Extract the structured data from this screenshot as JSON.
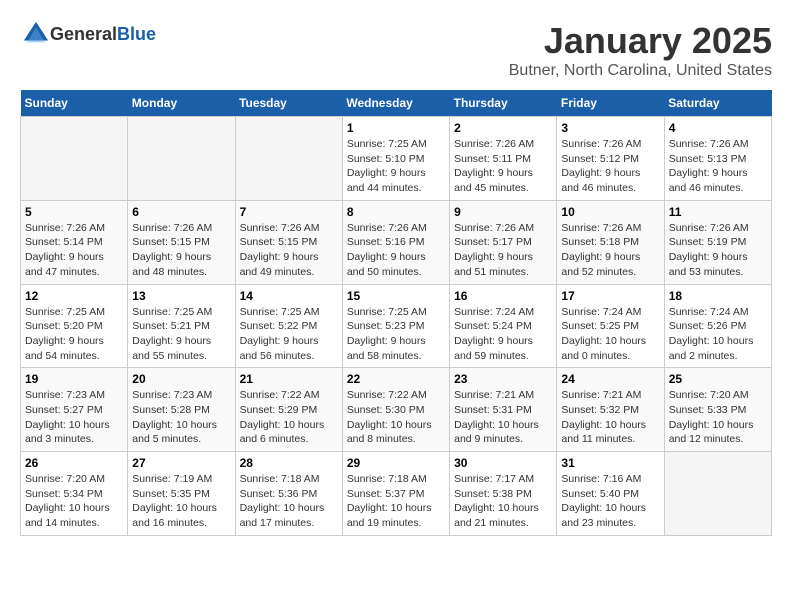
{
  "logo": {
    "text_general": "General",
    "text_blue": "Blue"
  },
  "title": "January 2025",
  "subtitle": "Butner, North Carolina, United States",
  "days_of_week": [
    "Sunday",
    "Monday",
    "Tuesday",
    "Wednesday",
    "Thursday",
    "Friday",
    "Saturday"
  ],
  "weeks": [
    [
      {
        "day": "",
        "sunrise": "",
        "sunset": "",
        "daylight": ""
      },
      {
        "day": "",
        "sunrise": "",
        "sunset": "",
        "daylight": ""
      },
      {
        "day": "",
        "sunrise": "",
        "sunset": "",
        "daylight": ""
      },
      {
        "day": "1",
        "sunrise": "Sunrise: 7:25 AM",
        "sunset": "Sunset: 5:10 PM",
        "daylight": "Daylight: 9 hours and 44 minutes."
      },
      {
        "day": "2",
        "sunrise": "Sunrise: 7:26 AM",
        "sunset": "Sunset: 5:11 PM",
        "daylight": "Daylight: 9 hours and 45 minutes."
      },
      {
        "day": "3",
        "sunrise": "Sunrise: 7:26 AM",
        "sunset": "Sunset: 5:12 PM",
        "daylight": "Daylight: 9 hours and 46 minutes."
      },
      {
        "day": "4",
        "sunrise": "Sunrise: 7:26 AM",
        "sunset": "Sunset: 5:13 PM",
        "daylight": "Daylight: 9 hours and 46 minutes."
      }
    ],
    [
      {
        "day": "5",
        "sunrise": "Sunrise: 7:26 AM",
        "sunset": "Sunset: 5:14 PM",
        "daylight": "Daylight: 9 hours and 47 minutes."
      },
      {
        "day": "6",
        "sunrise": "Sunrise: 7:26 AM",
        "sunset": "Sunset: 5:15 PM",
        "daylight": "Daylight: 9 hours and 48 minutes."
      },
      {
        "day": "7",
        "sunrise": "Sunrise: 7:26 AM",
        "sunset": "Sunset: 5:15 PM",
        "daylight": "Daylight: 9 hours and 49 minutes."
      },
      {
        "day": "8",
        "sunrise": "Sunrise: 7:26 AM",
        "sunset": "Sunset: 5:16 PM",
        "daylight": "Daylight: 9 hours and 50 minutes."
      },
      {
        "day": "9",
        "sunrise": "Sunrise: 7:26 AM",
        "sunset": "Sunset: 5:17 PM",
        "daylight": "Daylight: 9 hours and 51 minutes."
      },
      {
        "day": "10",
        "sunrise": "Sunrise: 7:26 AM",
        "sunset": "Sunset: 5:18 PM",
        "daylight": "Daylight: 9 hours and 52 minutes."
      },
      {
        "day": "11",
        "sunrise": "Sunrise: 7:26 AM",
        "sunset": "Sunset: 5:19 PM",
        "daylight": "Daylight: 9 hours and 53 minutes."
      }
    ],
    [
      {
        "day": "12",
        "sunrise": "Sunrise: 7:25 AM",
        "sunset": "Sunset: 5:20 PM",
        "daylight": "Daylight: 9 hours and 54 minutes."
      },
      {
        "day": "13",
        "sunrise": "Sunrise: 7:25 AM",
        "sunset": "Sunset: 5:21 PM",
        "daylight": "Daylight: 9 hours and 55 minutes."
      },
      {
        "day": "14",
        "sunrise": "Sunrise: 7:25 AM",
        "sunset": "Sunset: 5:22 PM",
        "daylight": "Daylight: 9 hours and 56 minutes."
      },
      {
        "day": "15",
        "sunrise": "Sunrise: 7:25 AM",
        "sunset": "Sunset: 5:23 PM",
        "daylight": "Daylight: 9 hours and 58 minutes."
      },
      {
        "day": "16",
        "sunrise": "Sunrise: 7:24 AM",
        "sunset": "Sunset: 5:24 PM",
        "daylight": "Daylight: 9 hours and 59 minutes."
      },
      {
        "day": "17",
        "sunrise": "Sunrise: 7:24 AM",
        "sunset": "Sunset: 5:25 PM",
        "daylight": "Daylight: 10 hours and 0 minutes."
      },
      {
        "day": "18",
        "sunrise": "Sunrise: 7:24 AM",
        "sunset": "Sunset: 5:26 PM",
        "daylight": "Daylight: 10 hours and 2 minutes."
      }
    ],
    [
      {
        "day": "19",
        "sunrise": "Sunrise: 7:23 AM",
        "sunset": "Sunset: 5:27 PM",
        "daylight": "Daylight: 10 hours and 3 minutes."
      },
      {
        "day": "20",
        "sunrise": "Sunrise: 7:23 AM",
        "sunset": "Sunset: 5:28 PM",
        "daylight": "Daylight: 10 hours and 5 minutes."
      },
      {
        "day": "21",
        "sunrise": "Sunrise: 7:22 AM",
        "sunset": "Sunset: 5:29 PM",
        "daylight": "Daylight: 10 hours and 6 minutes."
      },
      {
        "day": "22",
        "sunrise": "Sunrise: 7:22 AM",
        "sunset": "Sunset: 5:30 PM",
        "daylight": "Daylight: 10 hours and 8 minutes."
      },
      {
        "day": "23",
        "sunrise": "Sunrise: 7:21 AM",
        "sunset": "Sunset: 5:31 PM",
        "daylight": "Daylight: 10 hours and 9 minutes."
      },
      {
        "day": "24",
        "sunrise": "Sunrise: 7:21 AM",
        "sunset": "Sunset: 5:32 PM",
        "daylight": "Daylight: 10 hours and 11 minutes."
      },
      {
        "day": "25",
        "sunrise": "Sunrise: 7:20 AM",
        "sunset": "Sunset: 5:33 PM",
        "daylight": "Daylight: 10 hours and 12 minutes."
      }
    ],
    [
      {
        "day": "26",
        "sunrise": "Sunrise: 7:20 AM",
        "sunset": "Sunset: 5:34 PM",
        "daylight": "Daylight: 10 hours and 14 minutes."
      },
      {
        "day": "27",
        "sunrise": "Sunrise: 7:19 AM",
        "sunset": "Sunset: 5:35 PM",
        "daylight": "Daylight: 10 hours and 16 minutes."
      },
      {
        "day": "28",
        "sunrise": "Sunrise: 7:18 AM",
        "sunset": "Sunset: 5:36 PM",
        "daylight": "Daylight: 10 hours and 17 minutes."
      },
      {
        "day": "29",
        "sunrise": "Sunrise: 7:18 AM",
        "sunset": "Sunset: 5:37 PM",
        "daylight": "Daylight: 10 hours and 19 minutes."
      },
      {
        "day": "30",
        "sunrise": "Sunrise: 7:17 AM",
        "sunset": "Sunset: 5:38 PM",
        "daylight": "Daylight: 10 hours and 21 minutes."
      },
      {
        "day": "31",
        "sunrise": "Sunrise: 7:16 AM",
        "sunset": "Sunset: 5:40 PM",
        "daylight": "Daylight: 10 hours and 23 minutes."
      },
      {
        "day": "",
        "sunrise": "",
        "sunset": "",
        "daylight": ""
      }
    ]
  ]
}
